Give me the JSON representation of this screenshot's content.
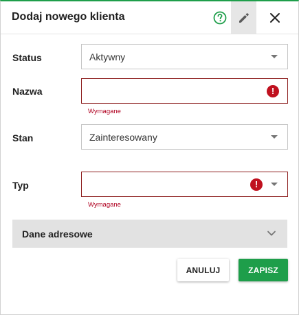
{
  "dialog": {
    "title": "Dodaj nowego klienta",
    "accent_color": "#1e9e4a",
    "error_color": "#b00020",
    "header_icons": [
      "help-icon",
      "pencil-icon",
      "close-icon"
    ]
  },
  "form": {
    "status": {
      "label": "Status",
      "value": "Aktywny"
    },
    "name": {
      "label": "Nazwa",
      "value": "",
      "helper": "Wymagane"
    },
    "state": {
      "label": "Stan",
      "value": "Zainteresowany"
    },
    "type": {
      "label": "Typ",
      "value": "",
      "helper": "Wymagane"
    }
  },
  "section": {
    "title": "Dane adresowe",
    "icon": "chevron-down-icon"
  },
  "actions": {
    "cancel_label": "ANULUJ",
    "save_label": "ZAPISZ"
  }
}
